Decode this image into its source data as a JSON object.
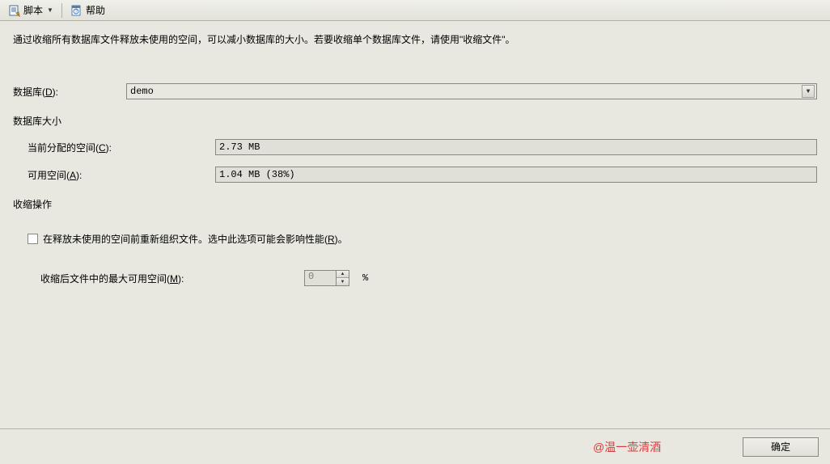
{
  "toolbar": {
    "script_label": "脚本",
    "help_label": "帮助"
  },
  "description": "通过收缩所有数据库文件释放未使用的空间，可以减小数据库的大小。若要收缩单个数据库文件，请使用\"收缩文件\"。",
  "database": {
    "label": "数据库(D):",
    "value": "demo"
  },
  "size_section": {
    "header": "数据库大小",
    "allocated_label": "当前分配的空间(C):",
    "allocated_value": "2.73 MB",
    "available_label": "可用空间(A):",
    "available_value": "1.04 MB (38%)"
  },
  "shrink_section": {
    "header": "收缩操作",
    "checkbox_label": "在释放未使用的空间前重新组织文件。选中此选项可能会影响性能(R)。",
    "spinner_label": "收缩后文件中的最大可用空间(M):",
    "spinner_value": "0",
    "percent": "%"
  },
  "footer": {
    "watermark": "@温一壶清酒",
    "ok_label": "确定"
  }
}
